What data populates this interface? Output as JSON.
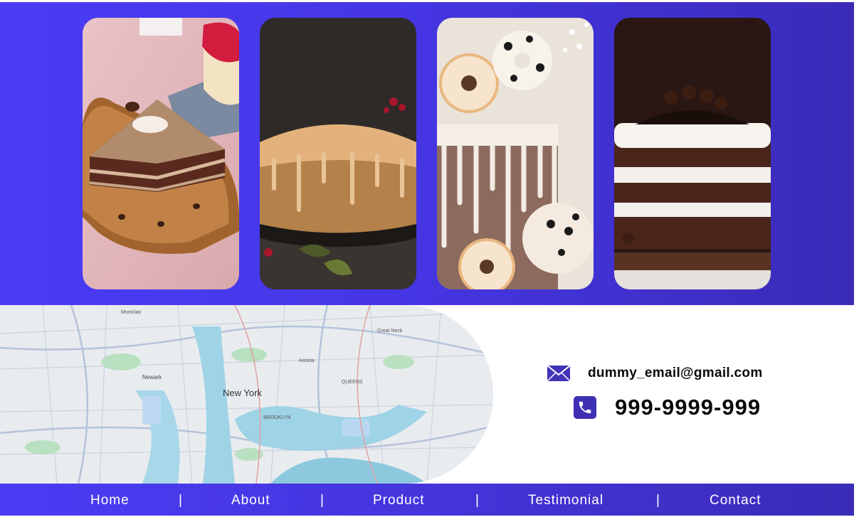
{
  "gallery": {
    "cards": [
      {
        "name": "slice-cake-image"
      },
      {
        "name": "bundt-cake-image"
      },
      {
        "name": "donut-drip-cake-image"
      },
      {
        "name": "chocolate-layer-cake-image"
      }
    ]
  },
  "map": {
    "city_label": "New York",
    "labels": [
      "Montclair",
      "Newark",
      "BROOKLYN",
      "QUEENS",
      "Great Neck",
      "Astoria"
    ]
  },
  "contact": {
    "email_icon": "mail-icon",
    "email": "dummy_email@gmail.com",
    "phone_icon": "phone-icon",
    "phone": "999-9999-999"
  },
  "footer": {
    "nav": [
      "Home",
      "About",
      "Product",
      "Testimonial",
      "Contact"
    ],
    "separator": "|"
  },
  "colors": {
    "brand": "#4a3cf5",
    "brand_dark": "#3a2bb8",
    "text": "#0a0a0a"
  }
}
